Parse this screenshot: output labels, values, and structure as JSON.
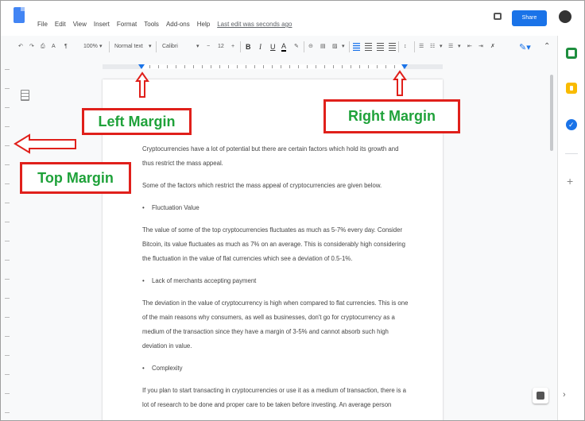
{
  "menu": {
    "items": [
      "File",
      "Edit",
      "View",
      "Insert",
      "Format",
      "Tools",
      "Add-ons",
      "Help"
    ],
    "last_edit": "Last edit was seconds ago",
    "share_label": "Share"
  },
  "toolbar": {
    "zoom": "100%",
    "style": "Normal text",
    "font": "Calibri",
    "font_size": "12",
    "bold": "B",
    "italic": "I",
    "underline": "U",
    "text_color": "A"
  },
  "document": {
    "paragraphs": [
      {
        "kind": "p",
        "text": "Cryptocurrencies have a lot of potential but there are certain factors which hold its growth and thus restrict the mass appeal."
      },
      {
        "kind": "p",
        "text": "Some of the factors which restrict the mass appeal of cryptocurrencies are given below."
      },
      {
        "kind": "bullet",
        "text": "Fluctuation Value"
      },
      {
        "kind": "p",
        "text": "The value of some of the top cryptocurrencies fluctuates as much as 5-7% every day. Consider Bitcoin, its value fluctuates as much as 7% on an average. This is considerably high considering the fluctuation in the value of flat currencies which see a deviation of 0.5-1%."
      },
      {
        "kind": "bullet",
        "text": "Lack of merchants accepting payment"
      },
      {
        "kind": "p",
        "text": "The deviation in the value of cryptocurrency is high when compared to flat currencies. This is one of the main reasons why consumers, as well as businesses, don't go for cryptocurrency as a medium of the transaction since they have a margin of 3-5% and cannot absorb such high deviation in value."
      },
      {
        "kind": "bullet",
        "text": "Complexity"
      },
      {
        "kind": "p",
        "text": "If you plan to start transacting in cryptocurrencies or use it as a medium of transaction, there is a lot of research to be done and proper care to be taken before investing. An average person"
      }
    ]
  },
  "annotations": {
    "left_margin": "Left Margin",
    "right_margin": "Right Margin",
    "top_margin": "Top Margin"
  },
  "colors": {
    "annotation_border": "#e0201b",
    "annotation_text": "#1fa23a",
    "accent": "#1a73e8"
  }
}
